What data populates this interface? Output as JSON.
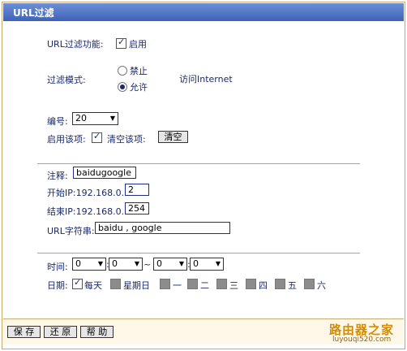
{
  "title": "URL过滤",
  "url_filter": {
    "label": "URL过滤功能:",
    "enable_label": "启用",
    "enabled": true
  },
  "mode": {
    "label": "过滤模式:",
    "options": [
      "禁止",
      "允许"
    ],
    "selected": "允许",
    "suffix": "访问Internet"
  },
  "entry": {
    "number_label": "编号:",
    "number_value": "20",
    "enable_label": "启用该项:",
    "enabled": true,
    "clear_label": "清空该项:",
    "clear_button": "清空"
  },
  "fields": {
    "note_label": "注释:",
    "note_value": "baidugoogle",
    "start_ip_label": "开始IP:192.168.0.",
    "start_ip_value": "2",
    "end_ip_label": "结束IP:192.168.0.",
    "end_ip_value": "254",
    "url_label": "URL字符串:",
    "url_value": "baidu , google"
  },
  "time": {
    "label": "时间:",
    "start_hour": "0",
    "start_min": "0",
    "tilde": "~",
    "end_hour": "0",
    "end_min": "0",
    "colon": ":"
  },
  "date": {
    "label": "日期:",
    "days": [
      {
        "label": "每天",
        "checked": true
      },
      {
        "label": "星期日",
        "checked": false
      },
      {
        "label": "一",
        "checked": false
      },
      {
        "label": "二",
        "checked": false
      },
      {
        "label": "三",
        "checked": false
      },
      {
        "label": "四",
        "checked": false
      },
      {
        "label": "五",
        "checked": false
      },
      {
        "label": "六",
        "checked": false
      }
    ]
  },
  "buttons": {
    "save": "保 存",
    "restore": "还 原",
    "help": "帮 助"
  },
  "watermark": {
    "text": "路由器之家",
    "url": "luyouqi520.com"
  }
}
